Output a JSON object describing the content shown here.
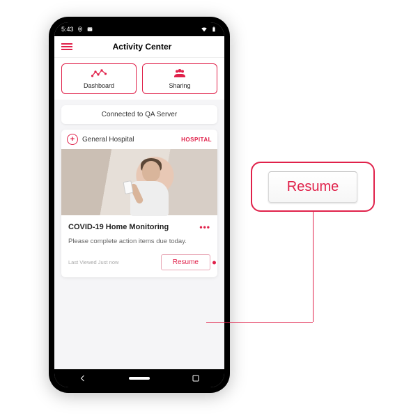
{
  "statusbar": {
    "time": "5:43"
  },
  "header": {
    "title": "Activity Center"
  },
  "tabs": {
    "dashboard": "Dashboard",
    "sharing": "Sharing"
  },
  "server_status": "Connected to QA Server",
  "card": {
    "org_name": "General Hospital",
    "org_badge": "HOSPITAL",
    "title": "COVID-19 Home Monitoring",
    "description": "Please complete action items due today.",
    "last_viewed": "Last Viewed Just now",
    "resume_label": "Resume"
  },
  "callout": {
    "resume_label": "Resume"
  },
  "colors": {
    "accent": "#e0214a"
  }
}
